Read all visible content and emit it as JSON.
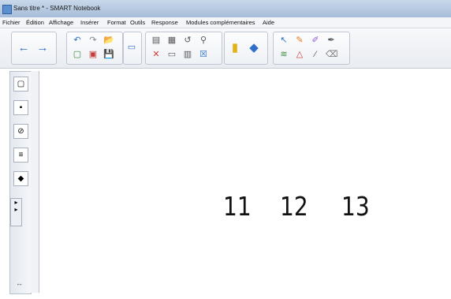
{
  "window": {
    "title": "Sans titre * - SMART Notebook"
  },
  "menu": [
    "Fichier",
    "Édition",
    "Affichage",
    "Insérer",
    "Format",
    "Outils",
    "Response",
    "Modules complémentaires",
    "Aide"
  ],
  "icons": {
    "back": "←",
    "forward": "→",
    "undo": "↶",
    "redo": "↷",
    "open": "📂",
    "save": "💾",
    "print": "⎙",
    "close": "✕",
    "eraser": "⌫",
    "pen": "✎",
    "select": "↖"
  },
  "canvas": {
    "handwritten_numbers": [
      "11",
      "12",
      "13"
    ]
  },
  "sidebar": {
    "collapse_label": "↔"
  },
  "colors": {
    "accent": "#2f6fc8",
    "toolbar_bg": "#eef1f5"
  }
}
